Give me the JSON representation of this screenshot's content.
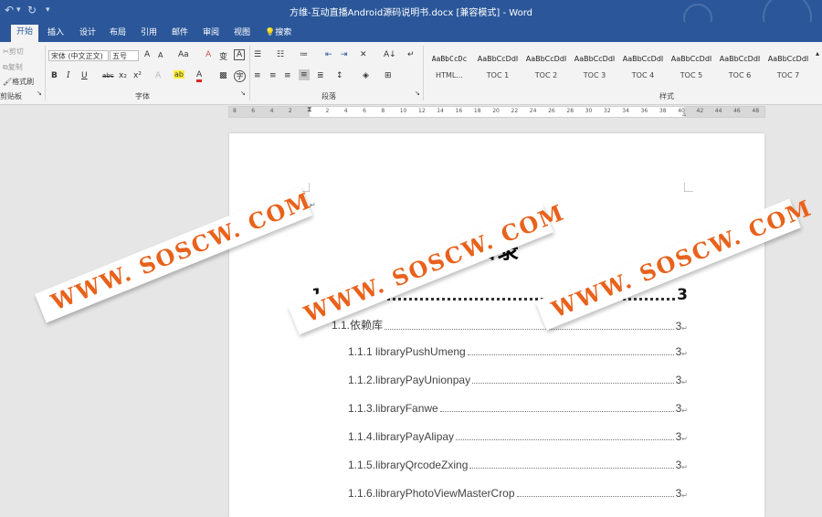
{
  "titlebar": {
    "doc_title": "方维-互动直播Android源码说明书.docx [兼容模式]  -  Word"
  },
  "tabs": [
    "开始",
    "插入",
    "设计",
    "布局",
    "引用",
    "邮件",
    "审阅",
    "视图"
  ],
  "tell_me": "搜索",
  "clipboard": {
    "cut": "剪切",
    "copy": "复制",
    "format_painter": "格式刷",
    "label": "剪贴板"
  },
  "font": {
    "name": "宋体 (中文正文)",
    "size": "五号",
    "label": "字体",
    "grow": "A",
    "shrink": "A",
    "case": "Aa",
    "clear": "A",
    "phonetic": "变",
    "border": "A",
    "bold": "B",
    "italic": "I",
    "underline": "U",
    "strike": "abc",
    "sub": "x₂",
    "sup": "x²",
    "effects": "A",
    "highlight": "ab",
    "color": "A",
    "circle": "字"
  },
  "paragraph": {
    "label": "段落",
    "sort": "A↓",
    "marks": "↵"
  },
  "styles": {
    "label": "样式",
    "items": [
      {
        "preview": "AaBbCcDc",
        "name": "HTML..."
      },
      {
        "preview": "AaBbCcDdI",
        "name": "TOC 1"
      },
      {
        "preview": "AaBbCcDdI",
        "name": "TOC 2"
      },
      {
        "preview": "AaBbCcDdI",
        "name": "TOC 3"
      },
      {
        "preview": "AaBbCcDdI",
        "name": "TOC 4"
      },
      {
        "preview": "AaBbCcDdI",
        "name": "TOC 5"
      },
      {
        "preview": "AaBbCcDdI",
        "name": "TOC 6"
      },
      {
        "preview": "AaBbCcDdI",
        "name": "TOC 7"
      }
    ]
  },
  "ruler": {
    "labels": [
      "8",
      "6",
      "4",
      "2",
      "",
      "2",
      "4",
      "6",
      "8",
      "10",
      "12",
      "14",
      "16",
      "18",
      "20",
      "22",
      "24",
      "26",
      "28",
      "30",
      "32",
      "34",
      "36",
      "38",
      "40",
      "42",
      "44",
      "46",
      "48"
    ]
  },
  "document": {
    "heading": "目录",
    "toc1": {
      "number": "1",
      "text": "类库",
      "page": "3"
    },
    "entries": [
      {
        "text": "1.1.依赖库",
        "page": "3"
      },
      {
        "text": "1.1.1 libraryPushUmeng",
        "page": "3"
      },
      {
        "text": "1.1.2.libraryPayUnionpay",
        "page": "3"
      },
      {
        "text": "1.1.3.libraryFanwe",
        "page": "3"
      },
      {
        "text": "1.1.4.libraryPayAlipay",
        "page": "3"
      },
      {
        "text": "1.1.5.libraryQrcodeZxing",
        "page": "3"
      },
      {
        "text": "1.1.6.libraryPhotoViewMasterCrop",
        "page": "3"
      }
    ]
  },
  "watermark": {
    "text": "WWW. SOSCW. COM"
  }
}
